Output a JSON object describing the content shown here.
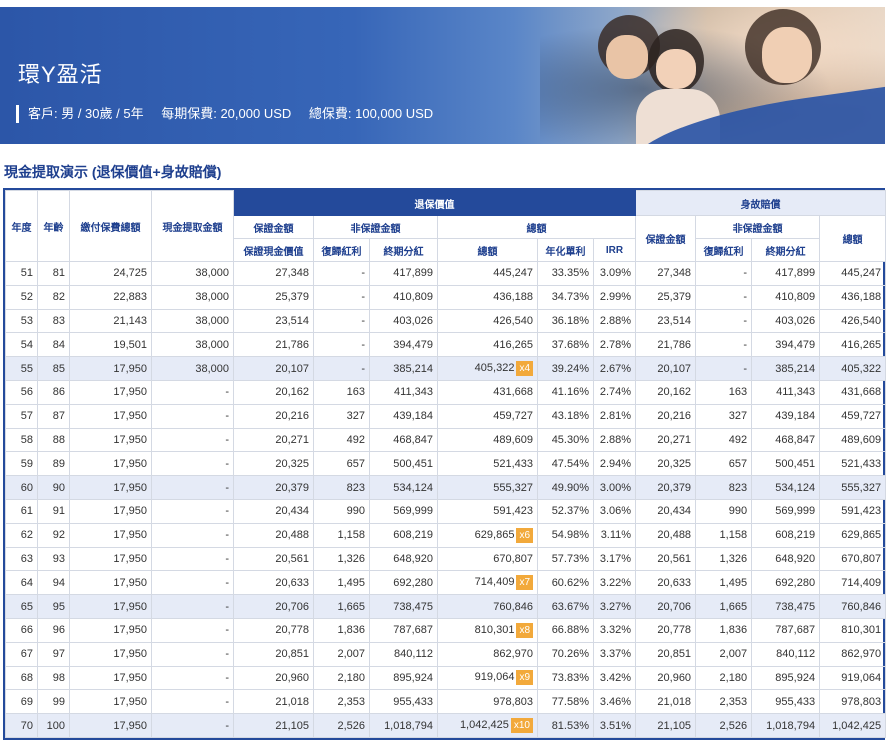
{
  "banner": {
    "title": "環Y盈活",
    "client": "客戶: 男 / 30歲 / 5年",
    "annual_premium": "每期保費: 20,000 USD",
    "total_premium": "總保費: 100,000 USD"
  },
  "section_title": "現金提取演示 (退保價值+身故賠償)",
  "table": {
    "h_policy_year": "年度",
    "h_age": "年齡",
    "h_total_premium_paid": "繳付保費總額",
    "h_cash_withdrawal": "現金提取金額",
    "h_surrender_value": "退保價值",
    "h_death_benefit": "身故賠償",
    "h_guaranteed_amount": "保證金額",
    "h_non_guaranteed_amount": "非保證金額",
    "h_total": "總額",
    "h_guaranteed_cash_value": "保證現金價值",
    "h_reversionary_bonus": "復歸紅利",
    "h_terminal_bonus": "終期分紅",
    "h_total_amount": "總額",
    "h_annualized_simple": "年化單利",
    "h_irr": "IRR",
    "h_db_guaranteed": "保證金額",
    "h_db_non_guaranteed": "非保證金額",
    "h_db_reversionary": "復歸紅利",
    "h_db_terminal": "終期分紅",
    "h_db_total": "總額",
    "rows": [
      {
        "year": "51",
        "age": "81",
        "paid": "24,725",
        "withdraw": "38,000",
        "gcv": "27,348",
        "rb": "-",
        "tb": "417,899",
        "total": "445,247",
        "mult": "",
        "simple": "33.35%",
        "irr": "3.09%",
        "db_g": "27,348",
        "db_rb": "-",
        "db_tb": "417,899",
        "db_total": "445,247",
        "hl": false
      },
      {
        "year": "52",
        "age": "82",
        "paid": "22,883",
        "withdraw": "38,000",
        "gcv": "25,379",
        "rb": "-",
        "tb": "410,809",
        "total": "436,188",
        "mult": "",
        "simple": "34.73%",
        "irr": "2.99%",
        "db_g": "25,379",
        "db_rb": "-",
        "db_tb": "410,809",
        "db_total": "436,188",
        "hl": false
      },
      {
        "year": "53",
        "age": "83",
        "paid": "21,143",
        "withdraw": "38,000",
        "gcv": "23,514",
        "rb": "-",
        "tb": "403,026",
        "total": "426,540",
        "mult": "",
        "simple": "36.18%",
        "irr": "2.88%",
        "db_g": "23,514",
        "db_rb": "-",
        "db_tb": "403,026",
        "db_total": "426,540",
        "hl": false
      },
      {
        "year": "54",
        "age": "84",
        "paid": "19,501",
        "withdraw": "38,000",
        "gcv": "21,786",
        "rb": "-",
        "tb": "394,479",
        "total": "416,265",
        "mult": "",
        "simple": "37.68%",
        "irr": "2.78%",
        "db_g": "21,786",
        "db_rb": "-",
        "db_tb": "394,479",
        "db_total": "416,265",
        "hl": false
      },
      {
        "year": "55",
        "age": "85",
        "paid": "17,950",
        "withdraw": "38,000",
        "gcv": "20,107",
        "rb": "-",
        "tb": "385,214",
        "total": "405,322",
        "mult": "x4",
        "simple": "39.24%",
        "irr": "2.67%",
        "db_g": "20,107",
        "db_rb": "-",
        "db_tb": "385,214",
        "db_total": "405,322",
        "hl": true
      },
      {
        "year": "56",
        "age": "86",
        "paid": "17,950",
        "withdraw": "-",
        "gcv": "20,162",
        "rb": "163",
        "tb": "411,343",
        "total": "431,668",
        "mult": "",
        "simple": "41.16%",
        "irr": "2.74%",
        "db_g": "20,162",
        "db_rb": "163",
        "db_tb": "411,343",
        "db_total": "431,668",
        "hl": false
      },
      {
        "year": "57",
        "age": "87",
        "paid": "17,950",
        "withdraw": "-",
        "gcv": "20,216",
        "rb": "327",
        "tb": "439,184",
        "total": "459,727",
        "mult": "",
        "simple": "43.18%",
        "irr": "2.81%",
        "db_g": "20,216",
        "db_rb": "327",
        "db_tb": "439,184",
        "db_total": "459,727",
        "hl": false
      },
      {
        "year": "58",
        "age": "88",
        "paid": "17,950",
        "withdraw": "-",
        "gcv": "20,271",
        "rb": "492",
        "tb": "468,847",
        "total": "489,609",
        "mult": "",
        "simple": "45.30%",
        "irr": "2.88%",
        "db_g": "20,271",
        "db_rb": "492",
        "db_tb": "468,847",
        "db_total": "489,609",
        "hl": false
      },
      {
        "year": "59",
        "age": "89",
        "paid": "17,950",
        "withdraw": "-",
        "gcv": "20,325",
        "rb": "657",
        "tb": "500,451",
        "total": "521,433",
        "mult": "",
        "simple": "47.54%",
        "irr": "2.94%",
        "db_g": "20,325",
        "db_rb": "657",
        "db_tb": "500,451",
        "db_total": "521,433",
        "hl": false
      },
      {
        "year": "60",
        "age": "90",
        "paid": "17,950",
        "withdraw": "-",
        "gcv": "20,379",
        "rb": "823",
        "tb": "534,124",
        "total": "555,327",
        "mult": "",
        "simple": "49.90%",
        "irr": "3.00%",
        "db_g": "20,379",
        "db_rb": "823",
        "db_tb": "534,124",
        "db_total": "555,327",
        "hl": true
      },
      {
        "year": "61",
        "age": "91",
        "paid": "17,950",
        "withdraw": "-",
        "gcv": "20,434",
        "rb": "990",
        "tb": "569,999",
        "total": "591,423",
        "mult": "",
        "simple": "52.37%",
        "irr": "3.06%",
        "db_g": "20,434",
        "db_rb": "990",
        "db_tb": "569,999",
        "db_total": "591,423",
        "hl": false
      },
      {
        "year": "62",
        "age": "92",
        "paid": "17,950",
        "withdraw": "-",
        "gcv": "20,488",
        "rb": "1,158",
        "tb": "608,219",
        "total": "629,865",
        "mult": "x6",
        "simple": "54.98%",
        "irr": "3.11%",
        "db_g": "20,488",
        "db_rb": "1,158",
        "db_tb": "608,219",
        "db_total": "629,865",
        "hl": false
      },
      {
        "year": "63",
        "age": "93",
        "paid": "17,950",
        "withdraw": "-",
        "gcv": "20,561",
        "rb": "1,326",
        "tb": "648,920",
        "total": "670,807",
        "mult": "",
        "simple": "57.73%",
        "irr": "3.17%",
        "db_g": "20,561",
        "db_rb": "1,326",
        "db_tb": "648,920",
        "db_total": "670,807",
        "hl": false
      },
      {
        "year": "64",
        "age": "94",
        "paid": "17,950",
        "withdraw": "-",
        "gcv": "20,633",
        "rb": "1,495",
        "tb": "692,280",
        "total": "714,409",
        "mult": "x7",
        "simple": "60.62%",
        "irr": "3.22%",
        "db_g": "20,633",
        "db_rb": "1,495",
        "db_tb": "692,280",
        "db_total": "714,409",
        "hl": false
      },
      {
        "year": "65",
        "age": "95",
        "paid": "17,950",
        "withdraw": "-",
        "gcv": "20,706",
        "rb": "1,665",
        "tb": "738,475",
        "total": "760,846",
        "mult": "",
        "simple": "63.67%",
        "irr": "3.27%",
        "db_g": "20,706",
        "db_rb": "1,665",
        "db_tb": "738,475",
        "db_total": "760,846",
        "hl": true
      },
      {
        "year": "66",
        "age": "96",
        "paid": "17,950",
        "withdraw": "-",
        "gcv": "20,778",
        "rb": "1,836",
        "tb": "787,687",
        "total": "810,301",
        "mult": "x8",
        "simple": "66.88%",
        "irr": "3.32%",
        "db_g": "20,778",
        "db_rb": "1,836",
        "db_tb": "787,687",
        "db_total": "810,301",
        "hl": false
      },
      {
        "year": "67",
        "age": "97",
        "paid": "17,950",
        "withdraw": "-",
        "gcv": "20,851",
        "rb": "2,007",
        "tb": "840,112",
        "total": "862,970",
        "mult": "",
        "simple": "70.26%",
        "irr": "3.37%",
        "db_g": "20,851",
        "db_rb": "2,007",
        "db_tb": "840,112",
        "db_total": "862,970",
        "hl": false
      },
      {
        "year": "68",
        "age": "98",
        "paid": "17,950",
        "withdraw": "-",
        "gcv": "20,960",
        "rb": "2,180",
        "tb": "895,924",
        "total": "919,064",
        "mult": "x9",
        "simple": "73.83%",
        "irr": "3.42%",
        "db_g": "20,960",
        "db_rb": "2,180",
        "db_tb": "895,924",
        "db_total": "919,064",
        "hl": false
      },
      {
        "year": "69",
        "age": "99",
        "paid": "17,950",
        "withdraw": "-",
        "gcv": "21,018",
        "rb": "2,353",
        "tb": "955,433",
        "total": "978,803",
        "mult": "",
        "simple": "77.58%",
        "irr": "3.46%",
        "db_g": "21,018",
        "db_rb": "2,353",
        "db_tb": "955,433",
        "db_total": "978,803",
        "hl": false
      },
      {
        "year": "70",
        "age": "100",
        "paid": "17,950",
        "withdraw": "-",
        "gcv": "21,105",
        "rb": "2,526",
        "tb": "1,018,794",
        "total": "1,042,425",
        "mult": "x10",
        "simple": "81.53%",
        "irr": "3.51%",
        "db_g": "21,105",
        "db_rb": "2,526",
        "db_tb": "1,018,794",
        "db_total": "1,042,425",
        "hl": true
      }
    ]
  }
}
